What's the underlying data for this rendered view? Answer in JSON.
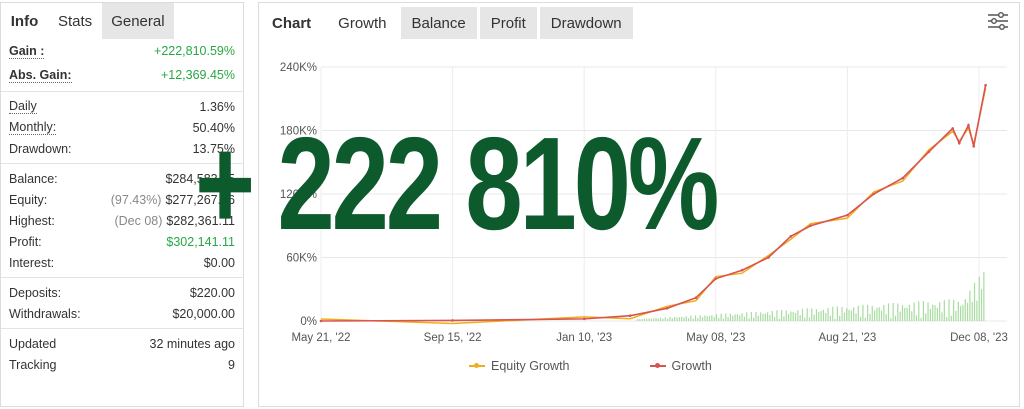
{
  "left": {
    "tabs": [
      {
        "label": "Info"
      },
      {
        "label": "Stats"
      },
      {
        "label": "General"
      }
    ],
    "gain": {
      "label": "Gain :",
      "value": "+222,810.59%"
    },
    "abs_gain": {
      "label": "Abs. Gain:",
      "value": "+12,369.45%"
    },
    "daily": {
      "label": "Daily",
      "value": "1.36%"
    },
    "monthly": {
      "label": "Monthly:",
      "value": "50.40%"
    },
    "drawdown": {
      "label": "Drawdown:",
      "value": "13.75%"
    },
    "balance": {
      "label": "Balance:",
      "value": "$284,583.75"
    },
    "equity": {
      "label": "Equity:",
      "note": "(97.43%)",
      "value": "$277,267.56"
    },
    "highest": {
      "label": "Highest:",
      "note": "(Dec 08)",
      "value": "$282,361.11"
    },
    "profit": {
      "label": "Profit:",
      "value": "$302,141.11"
    },
    "interest": {
      "label": "Interest:",
      "value": "$0.00"
    },
    "deposits": {
      "label": "Deposits:",
      "value": "$220.00"
    },
    "withdrawals": {
      "label": "Withdrawals:",
      "value": "$20,000.00"
    },
    "updated": {
      "label": "Updated",
      "value": "32 minutes ago"
    },
    "tracking": {
      "label": "Tracking",
      "value": "9"
    }
  },
  "right": {
    "tabs": [
      {
        "label": "Chart"
      },
      {
        "label": "Growth"
      },
      {
        "label": "Balance"
      },
      {
        "label": "Profit"
      },
      {
        "label": "Drawdown"
      }
    ],
    "icon": "filter-settings-icon"
  },
  "overlay": {
    "text": "+ 222 810%"
  },
  "colors": {
    "growth": "#d9534f",
    "equity": "#f0ad1e",
    "bars": "#a8dca0",
    "green": "#27a745",
    "overlay": "#0d5a2d"
  },
  "chart_data": {
    "type": "line",
    "title": "",
    "xlabel": "",
    "ylabel": "",
    "y_ticks": [
      "0%",
      "60K%",
      "120K%",
      "180K%",
      "240K%"
    ],
    "ylim": [
      0,
      240000
    ],
    "x_ticks": [
      "May 21, '22",
      "Sep 15, '22",
      "Jan 10, '23",
      "May 08, '23",
      "Aug 21, '23",
      "Dec 08, '23"
    ],
    "grid": true,
    "legend_position": "bottom",
    "series": [
      {
        "name": "Equity Growth",
        "color": "#f0ad1e"
      },
      {
        "name": "Growth",
        "color": "#d9534f"
      }
    ],
    "growth_points": [
      [
        "May 21, '22",
        0
      ],
      [
        "Sep 15, '22",
        500
      ],
      [
        "Jan 10, '23",
        2000
      ],
      [
        "Feb 20, '23",
        5000
      ],
      [
        "Mar 25, '23",
        12000
      ],
      [
        "Apr 20, '23",
        22000
      ],
      [
        "May 08, '23",
        40000
      ],
      [
        "Jun 01, '23",
        48000
      ],
      [
        "Jun 25, '23",
        60000
      ],
      [
        "Jul 15, '23",
        80000
      ],
      [
        "Aug 01, '23",
        90000
      ],
      [
        "Aug 21, '23",
        100000
      ],
      [
        "Sep 15, '23",
        120000
      ],
      [
        "Oct 10, '23",
        135000
      ],
      [
        "Nov 01, '23",
        160000
      ],
      [
        "Nov 20, '23",
        182000
      ],
      [
        "Nov 25, '23",
        168000
      ],
      [
        "Dec 02, '23",
        185000
      ],
      [
        "Dec 05, '23",
        165000
      ],
      [
        "Dec 08, '23",
        222810
      ]
    ]
  }
}
